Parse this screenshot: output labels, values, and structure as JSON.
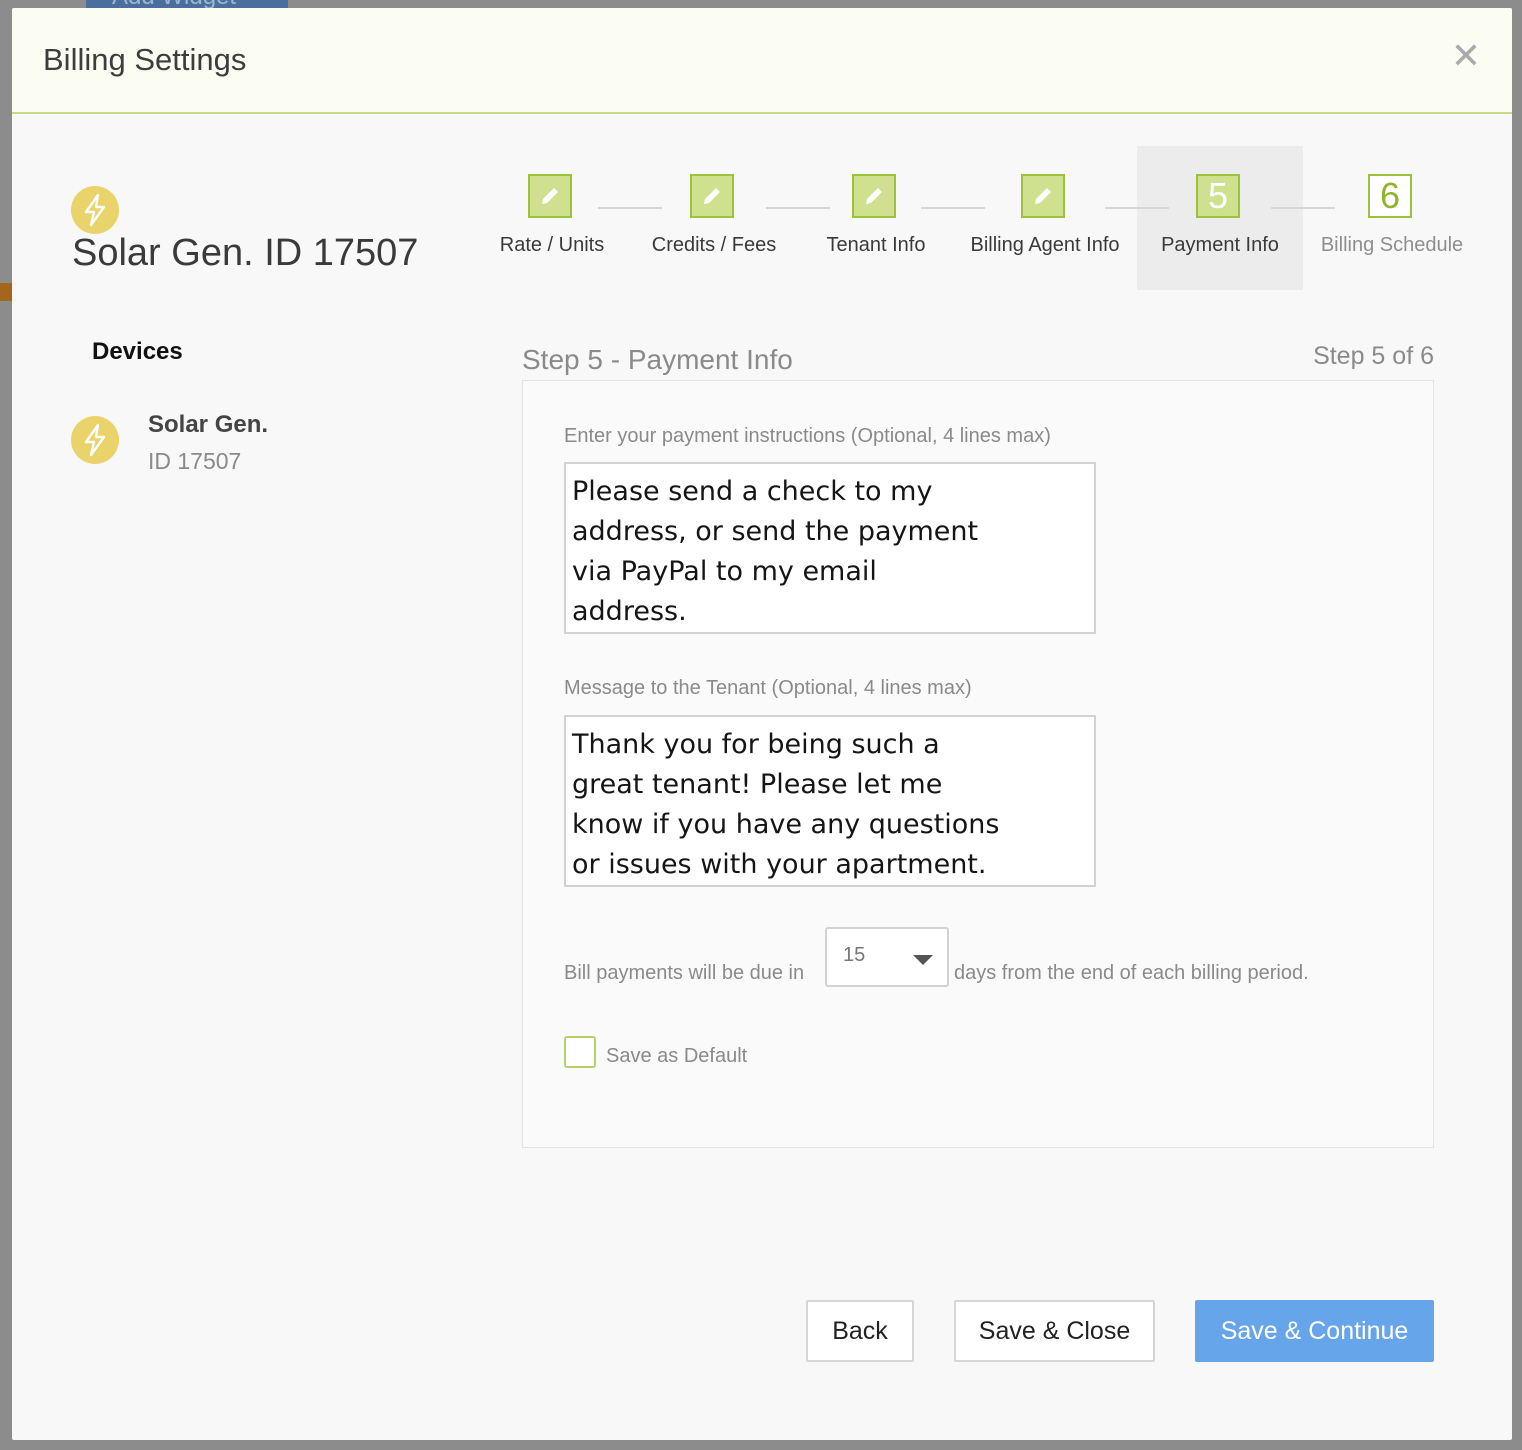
{
  "background": {
    "add_widget_label": "Add Widget"
  },
  "modal": {
    "title": "Billing Settings",
    "close_glyph": "✕"
  },
  "device_header": {
    "title": "Solar Gen. ID 17507",
    "icon": "bolt-icon"
  },
  "devices": {
    "heading": "Devices",
    "items": [
      {
        "name": "Solar Gen.",
        "id_label": "ID 17507",
        "icon": "bolt-icon"
      }
    ]
  },
  "stepper": {
    "steps": [
      {
        "label": "Rate / Units",
        "state": "done",
        "icon": "pencil-icon"
      },
      {
        "label": "Credits / Fees",
        "state": "done",
        "icon": "pencil-icon"
      },
      {
        "label": "Tenant Info",
        "state": "done",
        "icon": "pencil-icon"
      },
      {
        "label": "Billing Agent Info",
        "state": "done",
        "icon": "pencil-icon"
      },
      {
        "label": "Payment Info",
        "state": "active",
        "number": "5"
      },
      {
        "label": "Billing Schedule",
        "state": "pending",
        "number": "6"
      }
    ]
  },
  "step": {
    "heading": "Step 5 - Payment Info",
    "count": "Step 5 of 6"
  },
  "form": {
    "payment_instructions": {
      "label": "Enter your payment instructions (Optional, 4 lines max)",
      "value": "Please send a check to my\naddress, or send the payment\nvia PayPal to my email\naddress."
    },
    "tenant_message": {
      "label": "Message to the Tenant (Optional, 4 lines max)",
      "value": "Thank you for being such a\ngreat tenant! Please let me\nknow if you have any questions\nor issues with your apartment."
    },
    "due": {
      "prefix": "Bill payments will be due in",
      "value": "15",
      "suffix": "days from the end of each billing period."
    },
    "save_default": {
      "label": "Save as Default",
      "checked": false
    }
  },
  "buttons": {
    "back": "Back",
    "save_close": "Save & Close",
    "save_continue": "Save & Continue"
  },
  "colors": {
    "accent_green": "#9dc13f",
    "primary_blue": "#66a5ea",
    "bolt_yellow": "#ead36a"
  }
}
